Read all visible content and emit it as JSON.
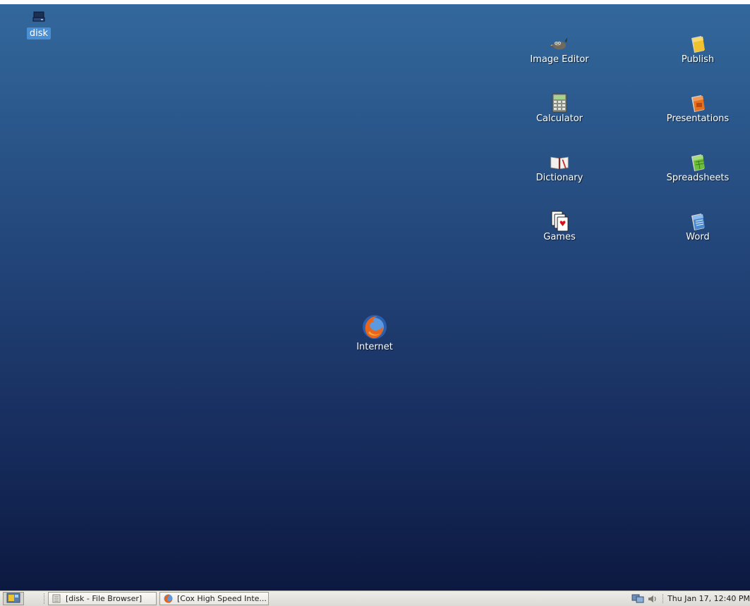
{
  "desktop": {
    "background_top": "#33689c",
    "background_bottom": "#0c1940",
    "icons": {
      "disk": {
        "label": "disk",
        "icon": "drive-icon"
      },
      "image_editor": {
        "label": "Image Editor",
        "icon": "gimp-icon"
      },
      "publish": {
        "label": "Publish",
        "icon": "publish-doc-icon"
      },
      "calculator": {
        "label": "Calculator",
        "icon": "calculator-icon"
      },
      "presentations": {
        "label": "Presentations",
        "icon": "presentation-doc-icon"
      },
      "dictionary": {
        "label": "Dictionary",
        "icon": "book-icon"
      },
      "spreadsheets": {
        "label": "Spreadsheets",
        "icon": "spreadsheet-doc-icon"
      },
      "games": {
        "label": "Games",
        "icon": "playing-cards-icon"
      },
      "word": {
        "label": "Word",
        "icon": "word-doc-icon"
      },
      "internet": {
        "label": "Internet",
        "icon": "firefox-icon"
      }
    }
  },
  "taskbar": {
    "start_icon": "start-menu-icon",
    "tasks": [
      {
        "label": "[disk - File Browser]",
        "icon": "file-browser-icon"
      },
      {
        "label": "[Cox High Speed Inte...",
        "icon": "firefox-icon"
      }
    ],
    "tray": {
      "network_icon": "network-icon",
      "volume_icon": "volume-icon"
    },
    "clock": "Thu Jan 17, 12:40 PM"
  }
}
